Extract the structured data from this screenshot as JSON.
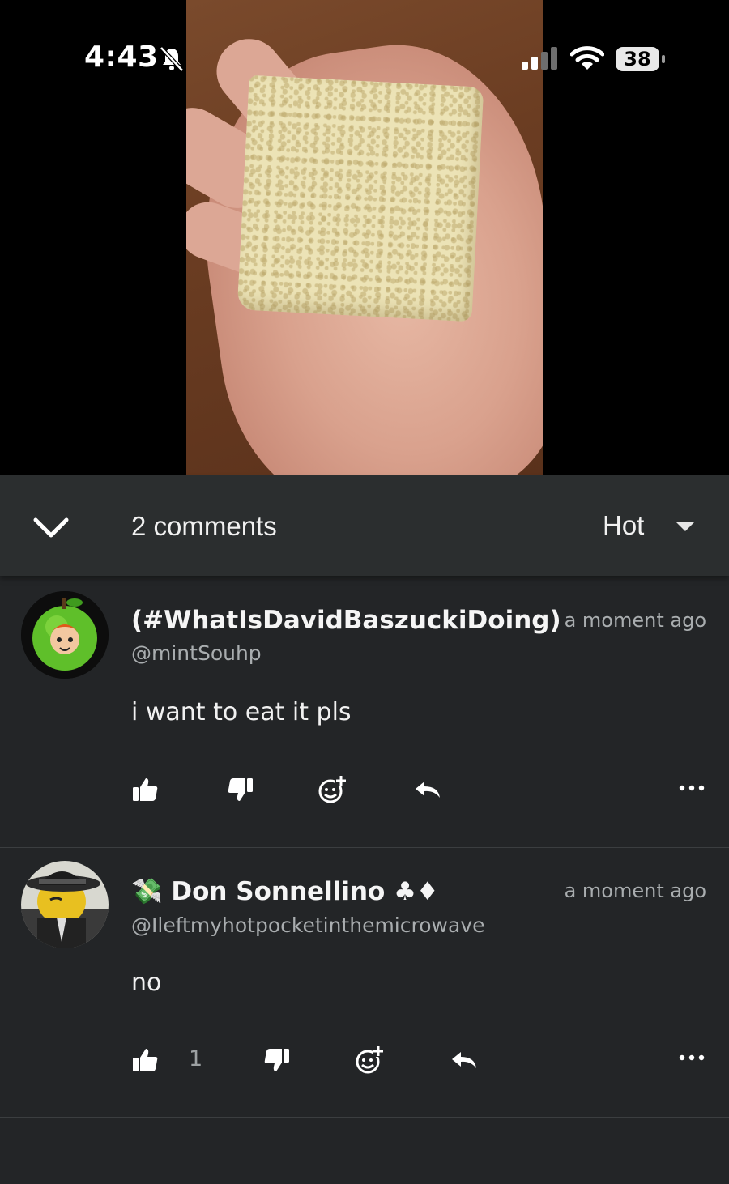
{
  "status_bar": {
    "time": "4:43",
    "battery": "38",
    "icons": [
      "bell-slash-icon",
      "cellular-signal-icon",
      "wifi-icon",
      "battery-icon"
    ]
  },
  "media": {
    "description_icon": "video-frame"
  },
  "comments_header": {
    "count_label": "2 comments",
    "sort_value": "Hot",
    "collapse_icon": "chevron-down-icon"
  },
  "comments": [
    {
      "display_name": "(#WhatIsDavidBaszuckiDoing)",
      "username": "@mintSouhp",
      "timestamp": "a moment ago",
      "text": "i want to eat it pls",
      "like_count": ""
    },
    {
      "display_name": "💸 Don Sonnellino ♣♦",
      "username": "@Ileftmyhotpocketinthemicrowave",
      "timestamp": "a moment ago",
      "text": "no",
      "like_count": "1"
    }
  ],
  "colors": {
    "background": "#232527",
    "header": "#2b2e2f",
    "text_primary": "#f1f1f1",
    "text_secondary": "#a9adaf"
  }
}
